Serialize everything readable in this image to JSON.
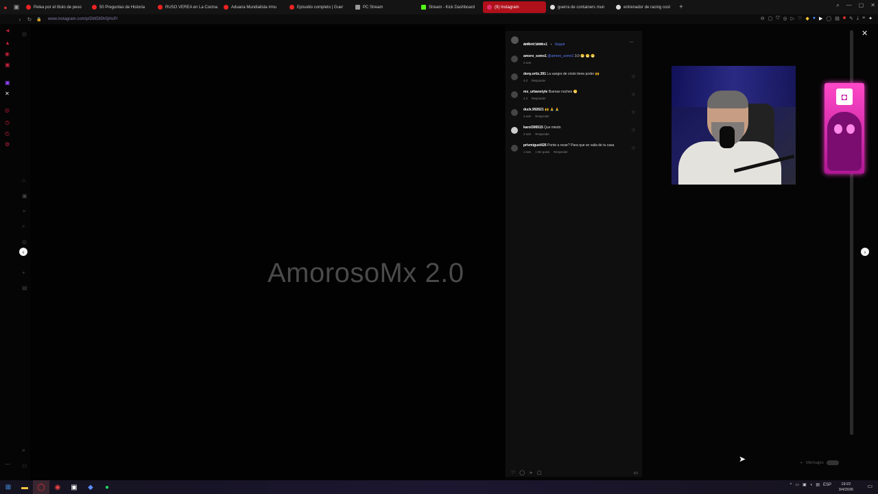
{
  "browser": {
    "tabs": [
      {
        "label": "Pelea por el título de peso",
        "color": "#e22"
      },
      {
        "label": "50 Preguntas de Historia",
        "color": "#e22"
      },
      {
        "label": "RUSO VEREA en La Cocina",
        "color": "#e22"
      },
      {
        "label": "Aduana Mundialista #mu",
        "color": "#e22"
      },
      {
        "label": "Episodio completo | Guer",
        "color": "#e22"
      },
      {
        "label": "PC Stream",
        "color": "#999"
      },
      {
        "label": "Stream - Kick Dashboard",
        "color": "#53fc18"
      },
      {
        "label": "(9) Instagram",
        "color": "#e1306c"
      },
      {
        "label": "guerra de containers mun",
        "color": "#ddd"
      },
      {
        "label": "entrenador de racing cost",
        "color": "#ddd"
      }
    ],
    "url": "www.instagram.com/p/DWDt5hSjHcP/"
  },
  "video": {
    "overlay_title": "AmorosoMx 2.0"
  },
  "post": {
    "author": "amoro_somx1",
    "separator": "•",
    "follow_label": "Seguir",
    "audio": "Audio original",
    "more": "···",
    "comments": [
      {
        "user": "amoro_somx1",
        "mention": "@amoro_somx1",
        "text": "3.0 😁 😁 😁",
        "meta": [
          "2 sem"
        ]
      },
      {
        "user": "deny.ortiz.391",
        "text": "La sangre de cristo tiene poder 🙌",
        "meta": [
          "4 d",
          "Responder"
        ]
      },
      {
        "user": "mx_urbanstyle",
        "text": "Buenas noches 😁",
        "meta": [
          "4 d",
          "Responder"
        ]
      },
      {
        "user": "duck.992621",
        "text": "🙌 🙏 🙏",
        "meta": [
          "2 sem",
          "Responder"
        ]
      },
      {
        "user": "karol306515",
        "text": "Que miedo",
        "meta": [
          "2 sem",
          "Responder"
        ]
      },
      {
        "user": "privmiguel426",
        "text": "Ponte a rezar? Para que se vaila de tu casa",
        "meta": [
          "1 sem",
          "1 Me gusta",
          "Responder"
        ]
      }
    ]
  },
  "messages_label": "Mensajes",
  "taskbar": {
    "lang": "ESP",
    "time": "19:22",
    "date": "3/4/2026"
  }
}
